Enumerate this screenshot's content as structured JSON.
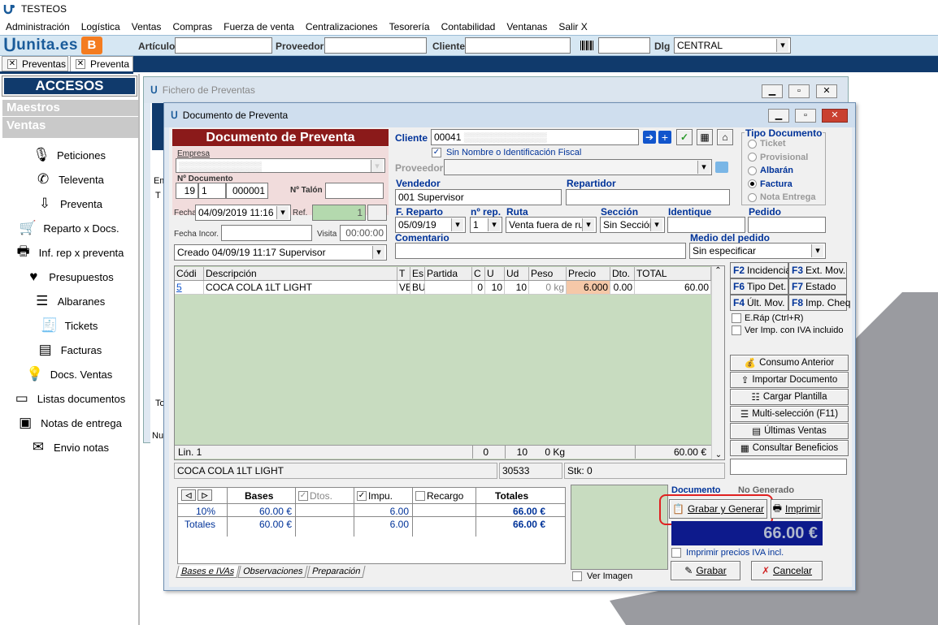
{
  "app": {
    "title": "TESTEOS"
  },
  "menu": [
    "Administración",
    "Logística",
    "Ventas",
    "Compras",
    "Fuerza de venta",
    "Centralizaciones",
    "Tesorería",
    "Contabilidad",
    "Ventanas",
    "Salir X"
  ],
  "toolbar": {
    "logo": "unita.es",
    "articulo_label": "Artículo",
    "proveedor_label": "Proveedor",
    "cliente_label": "Cliente",
    "dlg_label": "Dlg",
    "dlg_value": "CENTRAL"
  },
  "tabs": [
    {
      "label": "Preventas"
    },
    {
      "label": "Preventa"
    }
  ],
  "sidebar": {
    "title": "ACCESOS RAPIDOS",
    "sections": [
      "Maestros",
      "Ventas"
    ],
    "items": [
      {
        "label": "Peticiones",
        "icon": "microphone-icon"
      },
      {
        "label": "Televenta",
        "icon": "phone-icon"
      },
      {
        "label": "Preventa",
        "icon": "download-box-icon"
      },
      {
        "label": "Reparto x Docs.",
        "icon": "cart-icon"
      },
      {
        "label": "Inf. rep x preventa",
        "icon": "printer-icon"
      },
      {
        "label": "Presupuestos",
        "icon": "heart-icon"
      },
      {
        "label": "Albaranes",
        "icon": "list-icon"
      },
      {
        "label": "Tickets",
        "icon": "receipt-icon"
      },
      {
        "label": "Facturas",
        "icon": "cabinet-icon"
      },
      {
        "label": "Docs. Ventas",
        "icon": "bulb-icon"
      },
      {
        "label": "Listas documentos",
        "icon": "tape-icon"
      },
      {
        "label": "Notas de entrega",
        "icon": "safe-icon"
      },
      {
        "label": "Envio notas",
        "icon": "mail-icon"
      }
    ]
  },
  "back_window": {
    "title": "Fichero de Preventas",
    "frag_em": "Em",
    "frag_t": "T",
    "frag_to": "To",
    "frag_nu": "Nu"
  },
  "doc": {
    "window_title": "Documento de Preventa",
    "header": "Documento de Preventa",
    "empresa_label": "Empresa",
    "numdoc_label": "Nº Documento",
    "numdoc_a": "19",
    "numdoc_b": "1",
    "numdoc_c": "000001",
    "talon_label": "Nº Talón",
    "fecha_label": "Fecha",
    "fecha": "04/09/2019 11:16",
    "ref_label": "Ref.",
    "ref_value": "1",
    "fecha_incor_label": "Fecha Incor.",
    "visita_label": "Visita",
    "visita": "00:00:00",
    "creado": "Creado 04/09/19 11:17 Supervisor",
    "cliente_label": "Cliente",
    "cliente_code": "00041",
    "sin_nombre": "Sin Nombre o Identificación Fiscal",
    "proveedor_label": "Proveedor",
    "vendedor_label": "Vendedor",
    "vendedor": "001 Supervisor",
    "repartidor_label": "Repartidor",
    "freparto_label": "F. Reparto",
    "freparto": "05/09/19",
    "nrep_label": "nº rep.",
    "nrep": "1",
    "ruta_label": "Ruta",
    "ruta": "Venta fuera de ruta",
    "seccion_label": "Sección",
    "seccion": "Sin Sección",
    "identique_label": "Identique",
    "pedido_label": "Pedido",
    "comentario_label": "Comentario",
    "medio_label": "Medio del pedido",
    "medio": "Sin especificar",
    "tipo_doc": {
      "title": "Tipo Documento",
      "options": [
        {
          "label": "Ticket",
          "enabled": false,
          "selected": false
        },
        {
          "label": "Provisional",
          "enabled": false,
          "selected": false
        },
        {
          "label": "Albarán",
          "enabled": true,
          "selected": false
        },
        {
          "label": "Factura",
          "enabled": true,
          "selected": true
        },
        {
          "label": "Nota Entrega",
          "enabled": false,
          "selected": false
        }
      ]
    }
  },
  "grid": {
    "columns": [
      "Códi",
      "Descripción",
      "T",
      "Es",
      "Partida",
      "C",
      "U",
      "Ud",
      "Peso",
      "Precio",
      "Dto.",
      "TOTAL"
    ],
    "rows": [
      {
        "codigo": "5",
        "descripcion": "COCA COLA 1LT LIGHT",
        "t": "VE",
        "es": "BU",
        "partida": "",
        "c": "0",
        "u": "10",
        "ud": "10",
        "peso": "0 kg",
        "precio": "6.000",
        "dto": "0.00",
        "total": "60.00"
      }
    ],
    "footer": {
      "lin": "Lin. 1",
      "c": "0",
      "ud": "10",
      "peso": "0 Kg",
      "total": "60.00 €"
    },
    "status": {
      "desc": "COCA COLA 1LT LIGHT",
      "code": "30533",
      "stk": "Stk: 0"
    }
  },
  "fkeys": [
    {
      "key": "F2",
      "label": "Incidencia"
    },
    {
      "key": "F3",
      "label": "Ext. Mov."
    },
    {
      "key": "F6",
      "label": "Tipo Det."
    },
    {
      "key": "F7",
      "label": "Estado"
    },
    {
      "key": "F4",
      "label": "Últ. Mov."
    },
    {
      "key": "F8",
      "label": "Imp. Cheq"
    }
  ],
  "options": {
    "erap": "E.Ráp (Ctrl+R)",
    "ver_iva": "Ver Imp. con IVA incluido"
  },
  "actions": [
    "Consumo Anterior",
    "Importar Documento",
    "Cargar Plantilla",
    "Multi-selección (F11)",
    "Últimas Ventas",
    "Consultar Beneficios"
  ],
  "totals": {
    "headers": {
      "bases": "Bases",
      "dtos": "Dtos.",
      "impu": "Impu.",
      "recargo": "Recargo",
      "totales": "Totales"
    },
    "rows": [
      {
        "label": "10%",
        "bases": "60.00 €",
        "impu": "6.00",
        "totales": "66.00 €"
      },
      {
        "label": "Totales",
        "bases": "60.00 €",
        "impu": "6.00",
        "totales": "66.00 €"
      }
    ],
    "tabs": [
      "Bases e IVAs",
      "Observaciones",
      "Preparación"
    ]
  },
  "bottom": {
    "documento_label": "Documento",
    "documento_state": "No Generado",
    "grabar_generar": "Grabar y Generar",
    "imprimir": "Imprimir",
    "total": "66.00 €",
    "imprimir_iva": "Imprimir precios IVA incl.",
    "ver_imagen": "Ver Imagen",
    "grabar": "Grabar",
    "cancelar": "Cancelar"
  }
}
